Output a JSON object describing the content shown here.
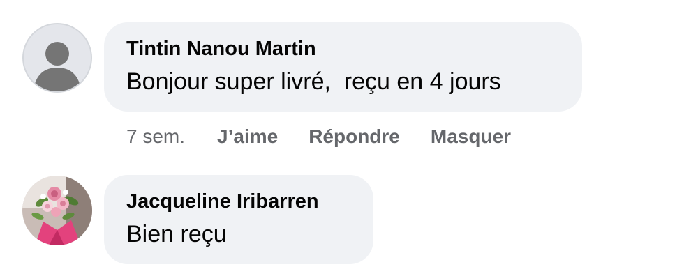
{
  "comments": [
    {
      "author": "Tintin Nanou Martin",
      "text": "Bonjour super livré,  reçu en 4 jours",
      "avatar": "default-user-icon",
      "time": "7 sem.",
      "actions": {
        "like": "J’aime",
        "reply": "Répondre",
        "hide": "Masquer"
      }
    },
    {
      "author": "Jacqueline Iribarren",
      "text": "Bien reçu",
      "avatar": "flower-bouquet-photo"
    }
  ],
  "colors": {
    "bubble": "#f0f2f5",
    "text": "#050505",
    "secondary": "#65676b",
    "avatar_bg": "#e4e6eb",
    "avatar_glyph": "#757575"
  }
}
